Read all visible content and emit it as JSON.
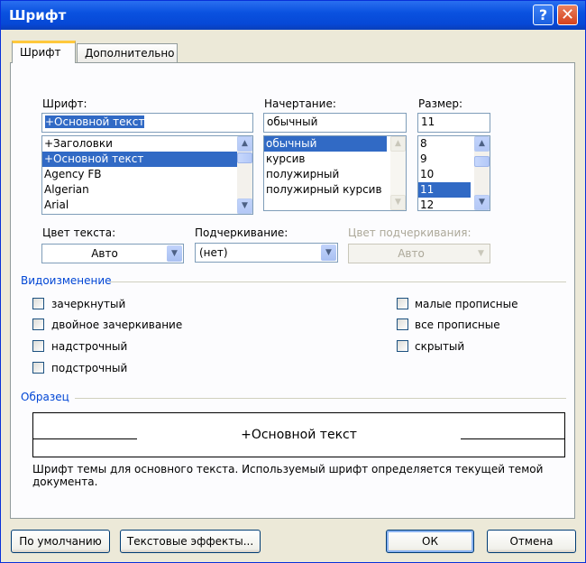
{
  "window": {
    "title": "Шрифт",
    "help_glyph": "?",
    "close_glyph": "✕"
  },
  "tabs": [
    {
      "label": "Шрифт",
      "active": true
    },
    {
      "label": "Дополнительно",
      "active": false
    }
  ],
  "font": {
    "label": "Шрифт:",
    "value": "+Основной текст",
    "items": [
      "+Заголовки",
      "+Основной текст",
      "Agency FB",
      "Algerian",
      "Arial"
    ],
    "selected_index": 1
  },
  "style": {
    "label": "Начертание:",
    "value": "обычный",
    "items": [
      "обычный",
      "курсив",
      "полужирный",
      "полужирный курсив"
    ],
    "selected_index": 0
  },
  "size": {
    "label": "Размер:",
    "value": "11",
    "items": [
      "8",
      "9",
      "10",
      "11",
      "12"
    ],
    "selected_index": 3
  },
  "text_color": {
    "label": "Цвет текста:",
    "value": "Авто"
  },
  "underline": {
    "label": "Подчеркивание:",
    "value": "(нет)"
  },
  "underline_color": {
    "label": "Цвет подчеркивания:",
    "value": "Авто",
    "disabled": true
  },
  "effects": {
    "title": "Видоизменение",
    "left": [
      {
        "label": "зачеркнутый",
        "checked": false
      },
      {
        "label": "двойное зачеркивание",
        "checked": false
      },
      {
        "label": "надстрочный",
        "checked": false
      },
      {
        "label": "подстрочный",
        "checked": false
      }
    ],
    "right": [
      {
        "label": "малые прописные",
        "checked": false
      },
      {
        "label": "все прописные",
        "checked": false
      },
      {
        "label": "скрытый",
        "checked": false
      }
    ]
  },
  "preview": {
    "title": "Образец",
    "sample": "+Основной текст",
    "description": "Шрифт темы для основного текста. Используемый шрифт определяется текущей темой документа."
  },
  "buttons": {
    "default": "По умолчанию",
    "text_effects": "Текстовые эффекты...",
    "ok": "ОК",
    "cancel": "Отмена"
  },
  "icons": {
    "scroll_up": "chevron-up-icon",
    "scroll_down": "chevron-down-icon",
    "dropdown": "chevron-down-icon"
  },
  "colors": {
    "selection": "#316ac5",
    "group_title": "#0046d5",
    "titlebar": "#0a52e0"
  }
}
